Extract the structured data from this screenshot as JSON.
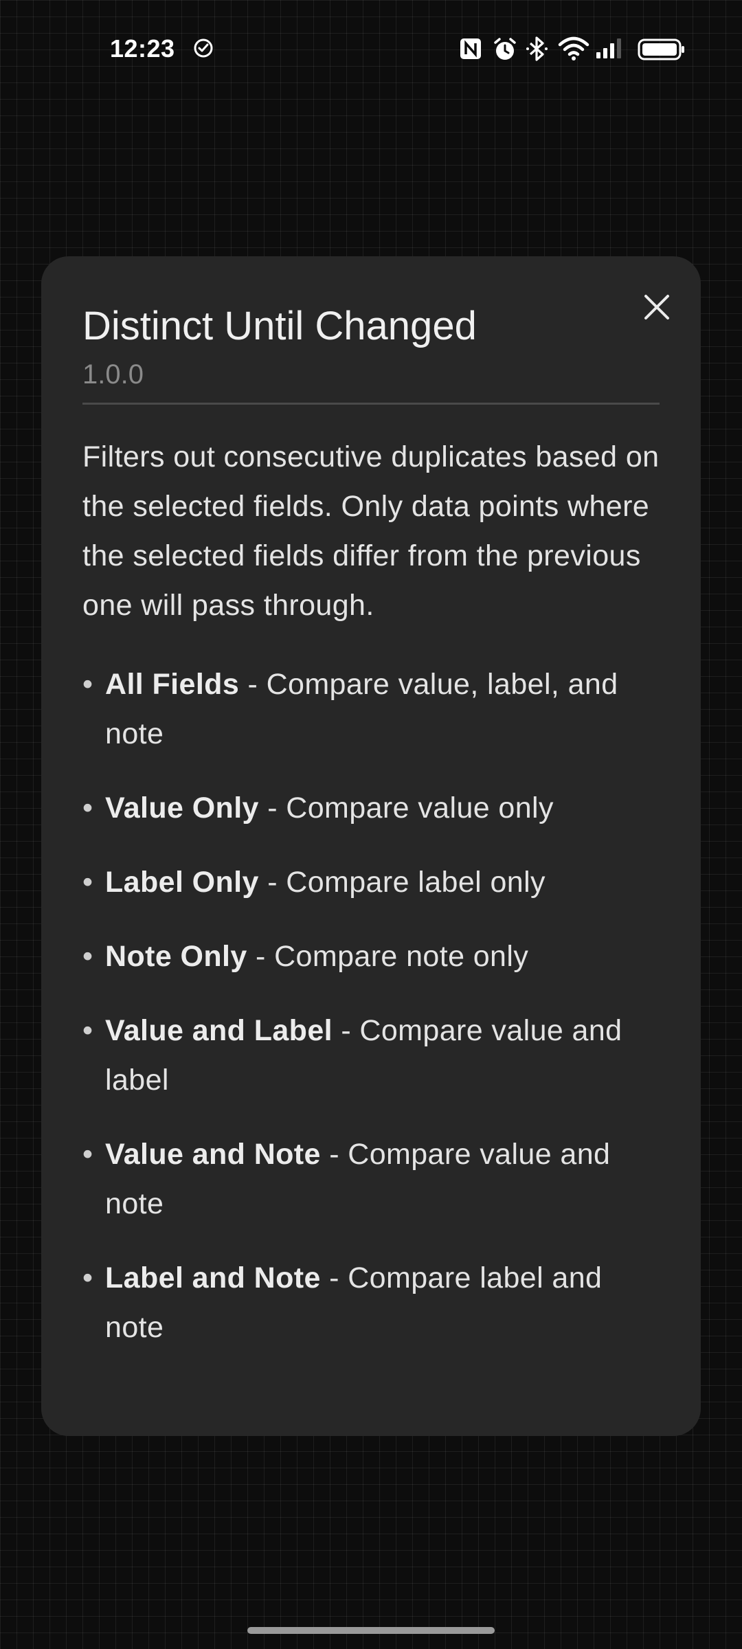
{
  "status_bar": {
    "time": "12:23",
    "icons": [
      "check-circle-icon",
      "nfc-icon",
      "alarm-icon",
      "bluetooth-icon",
      "wifi-icon",
      "signal-icon",
      "battery-icon"
    ]
  },
  "dialog": {
    "title": "Distinct Until Changed",
    "version": "1.0.0",
    "close_icon": "close-icon",
    "description": "Filters out consecutive duplicates based on the selected fields. Only data points where the selected fields differ from the previous one will pass through.",
    "options": [
      {
        "name": "All Fields",
        "text": " - Compare value, label, and note"
      },
      {
        "name": "Value Only",
        "text": " - Compare value only"
      },
      {
        "name": "Label Only",
        "text": " - Compare label only"
      },
      {
        "name": "Note Only",
        "text": " - Compare note only"
      },
      {
        "name": "Value and Label",
        "text": " - Compare value and label"
      },
      {
        "name": "Value and Note",
        "text": " - Compare value and note"
      },
      {
        "name": "Label and Note",
        "text": " - Compare label and note"
      }
    ]
  },
  "colors": {
    "background": "#0d0d0d",
    "dialog": "#272727",
    "text": "#e4e4e4",
    "muted": "#8a8a8a"
  }
}
